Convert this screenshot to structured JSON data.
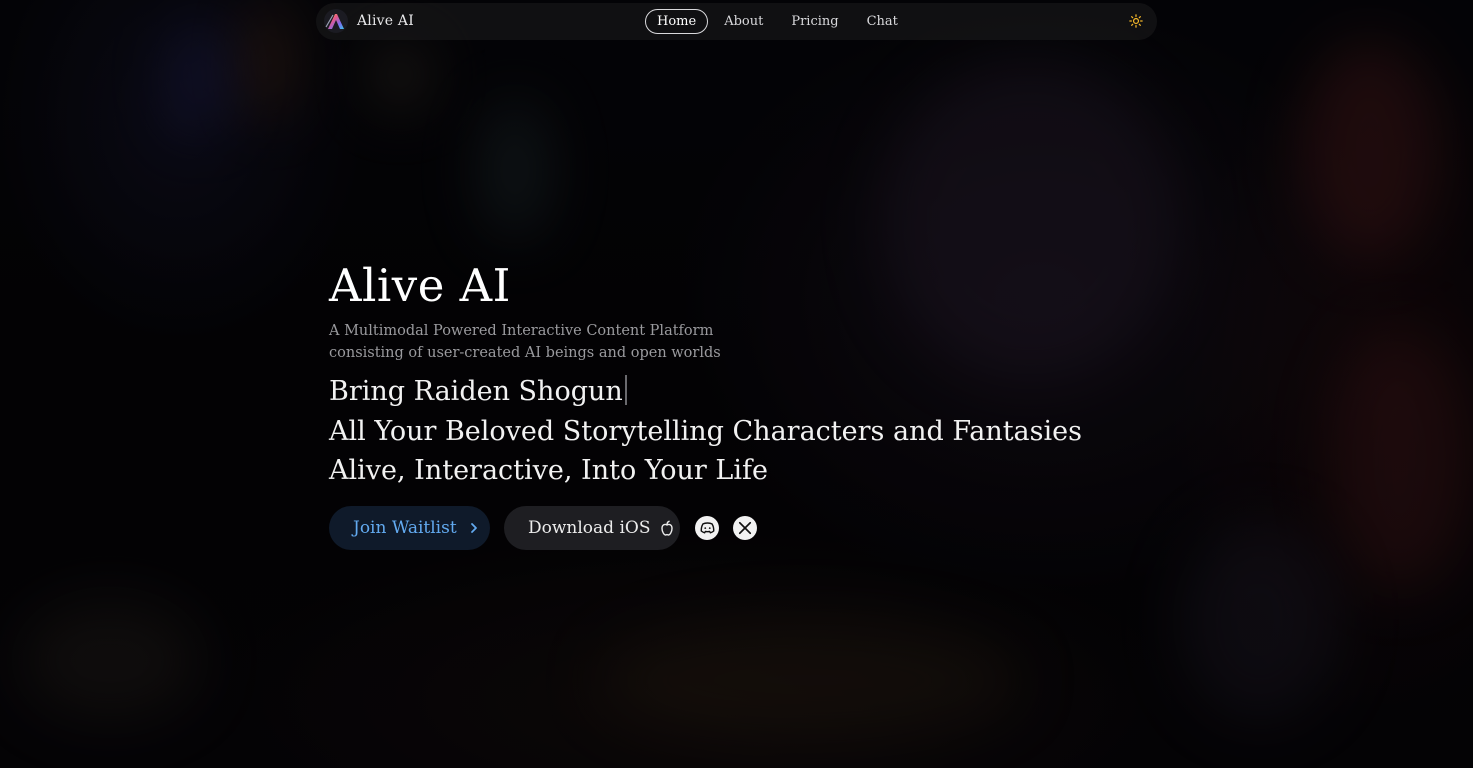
{
  "nav": {
    "brand_name": "Alive AI",
    "links": [
      {
        "label": "Home",
        "active": true
      },
      {
        "label": "About",
        "active": false
      },
      {
        "label": "Pricing",
        "active": false
      },
      {
        "label": "Chat",
        "active": false
      }
    ],
    "theme_toggle_icon": "sun-icon"
  },
  "hero": {
    "title": "Alive AI",
    "subtitle_line1": "A Multimodal Powered Interactive Content Platform",
    "subtitle_line2": "consisting of user-created AI beings and open worlds",
    "tagline_typed": "Bring Raiden Shogun",
    "tagline_line2": "All Your Beloved Storytelling Characters and Fantasies",
    "tagline_line3": "Alive, Interactive, Into Your Life"
  },
  "actions": {
    "waitlist_label": "Join Waitlist",
    "waitlist_icon": "chevron-right-icon",
    "ios_label": "Download iOS",
    "ios_icon": "apple-icon",
    "social_icons": [
      "discord-icon",
      "x-twitter-icon"
    ]
  },
  "colors": {
    "accent_blue": "#62aaf0",
    "waitlist_bg": "#0f1a2a",
    "ios_bg": "#1e1e22",
    "sun_icon": "#f0b429"
  }
}
